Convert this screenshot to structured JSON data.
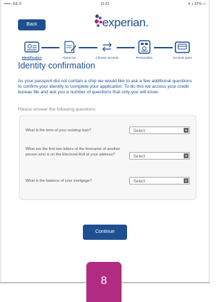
{
  "statusbar": {
    "left": "•••••○ EE ✆",
    "time": "11:23",
    "right": "✈ ◐ 67% ▭"
  },
  "header": {
    "back_label": "Back",
    "brand": "experian."
  },
  "steps": [
    {
      "label": "Identification",
      "icon": "id-card-icon",
      "active": true
    },
    {
      "label": "About me",
      "icon": "document-pencil-icon",
      "active": false
    },
    {
      "label": "Choose account",
      "icon": "swap-arrows-icon",
      "active": false
    },
    {
      "label": "Personalise",
      "icon": "pin-pad-icon",
      "active": false
    },
    {
      "label": "Account open",
      "icon": "card-reader-icon",
      "active": false
    }
  ],
  "page_title": "Identity confirmation",
  "intro_text": "As your passport did not contain a chip we would like to ask a few additional questions to confirm your identity to complete your application. To do this we access your credit bureau file and ask you a number of questions that only you will know.",
  "questions_prompt": "Please answer the following questions:",
  "questions": [
    {
      "text": "What is the term of your existing loan?",
      "select": "Select"
    },
    {
      "text": "What are the first two letters of the forename of another person who is on the Electoral Roll at your address?",
      "select": "Select"
    },
    {
      "text": "What is the balance of your mortgage?",
      "select": "Select"
    }
  ],
  "continue_label": "Continue",
  "slide_number": "8",
  "colors": {
    "brand_blue": "#1d4f91",
    "badge": "#b22b82"
  }
}
